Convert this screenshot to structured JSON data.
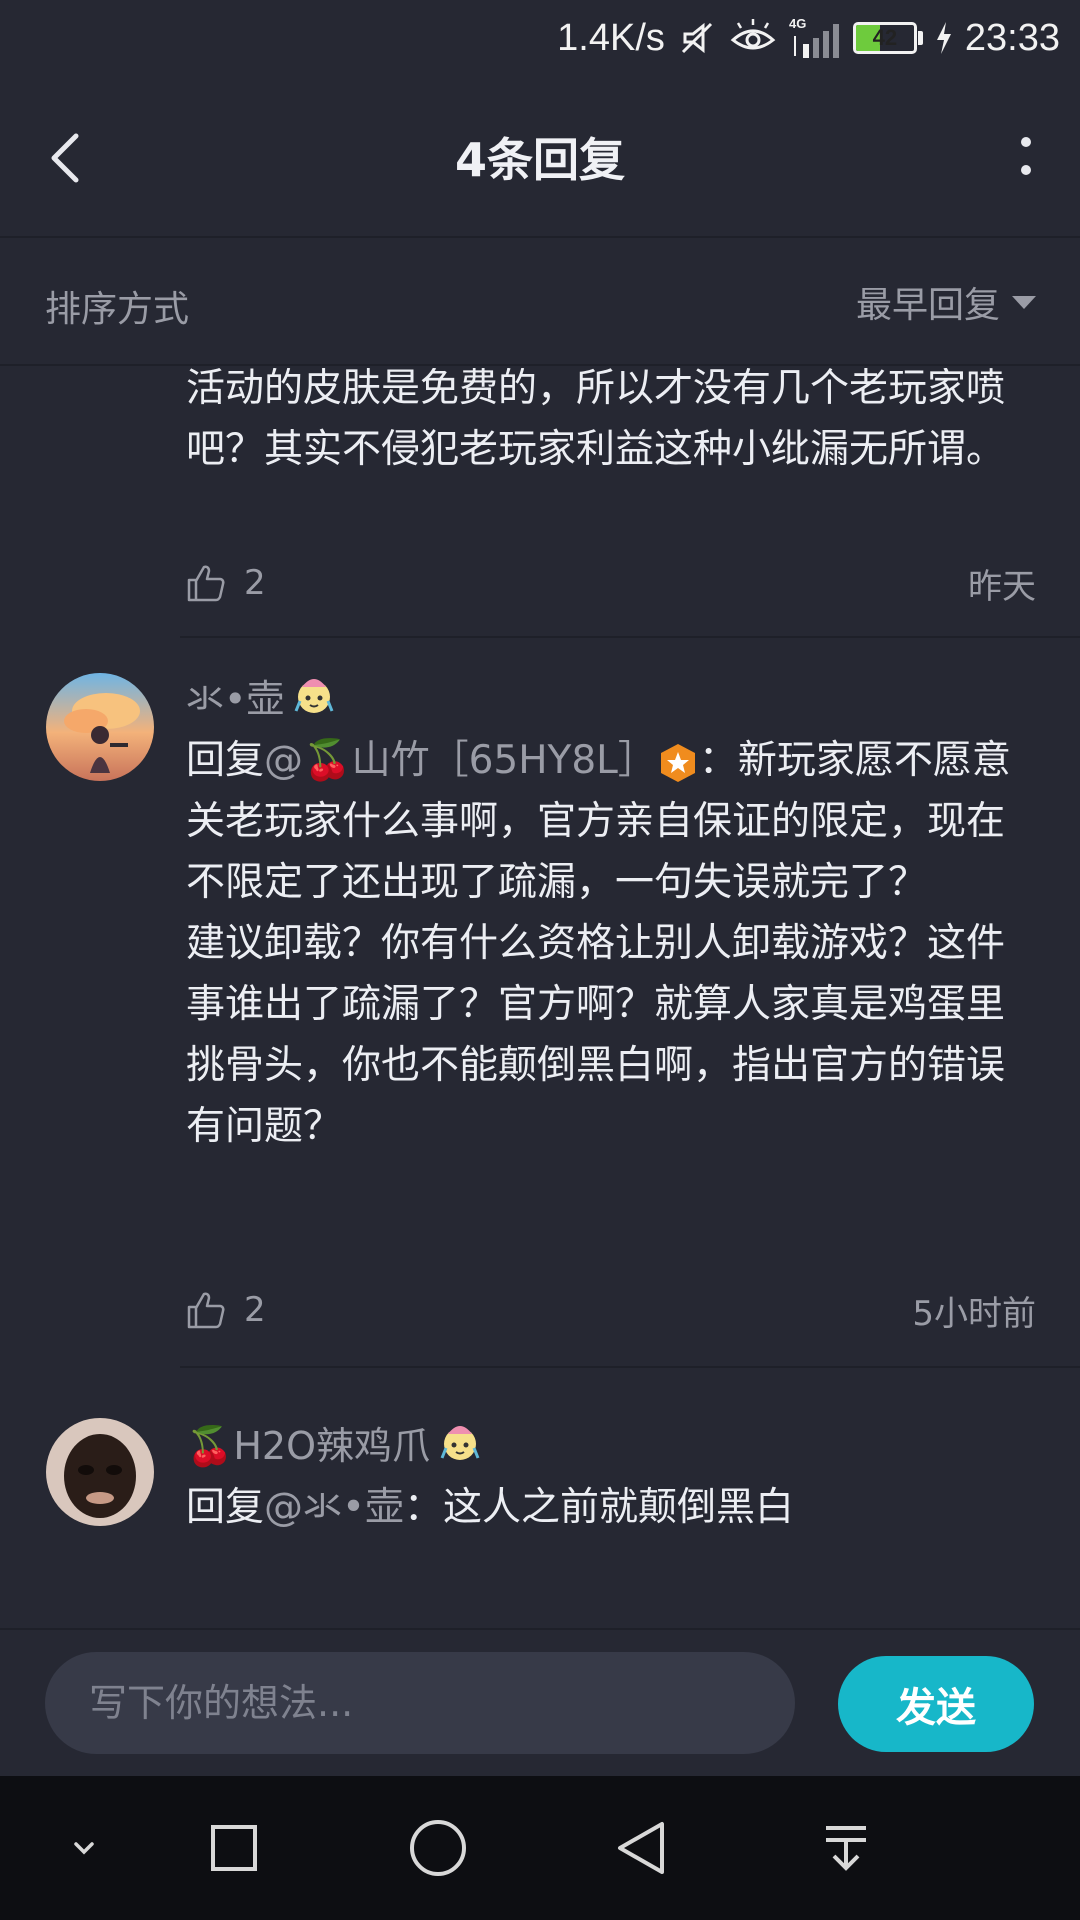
{
  "status_bar": {
    "net_speed": "1.4K/s",
    "network_type": "4G",
    "battery_level": "42",
    "battery_fraction": 0.42,
    "time": "23:33",
    "icons": [
      "mute-icon",
      "eye-icon",
      "signal-icon",
      "battery-icon",
      "charging-icon"
    ]
  },
  "header": {
    "title": "4条回复",
    "icons": [
      "back-arrow-icon",
      "more-vertical-icon"
    ]
  },
  "sort": {
    "label": "排序方式",
    "selected": "最早回复"
  },
  "comments": [
    {
      "text": "活动的皮肤是免费的，所以才没有几个老玩家喷吧？其实不侵犯老玩家利益这种小纰漏无所谓。",
      "likes": "2",
      "time": "昨天"
    },
    {
      "username": "氺•壶",
      "reply_prefix": "回复",
      "mention": "@🍒山竹［65HY8L］",
      "text_inline": "：新玩家愿不愿意关老玩家什么事啊，官方亲自保证的限定，现在不限定了还出现了疏漏，一句失误就完了？",
      "text_more": "建议卸载？你有什么资格让别人卸载游戏？这件事谁出了疏漏了？官方啊？就算人家真是鸡蛋里挑骨头，你也不能颠倒黑白啊，指出官方的错误有问题？",
      "likes": "2",
      "time": "5小时前"
    },
    {
      "username": "🍒H2O辣鸡爪",
      "reply_prefix": "回复",
      "mention": "@氺•壶",
      "text_inline": "：这人之前就颠倒黑白"
    }
  ],
  "input": {
    "placeholder": "写下你的想法...",
    "send_label": "发送"
  },
  "colors": {
    "background": "#262833",
    "accent": "#17b7c9",
    "muted_text": "#9a9ca6",
    "input_bg": "#373a48",
    "nav_bg": "#0d0e12"
  },
  "nav_icons": [
    "collapse-down-icon",
    "recents-square-icon",
    "home-circle-icon",
    "back-triangle-icon",
    "notifications-pull-icon"
  ]
}
